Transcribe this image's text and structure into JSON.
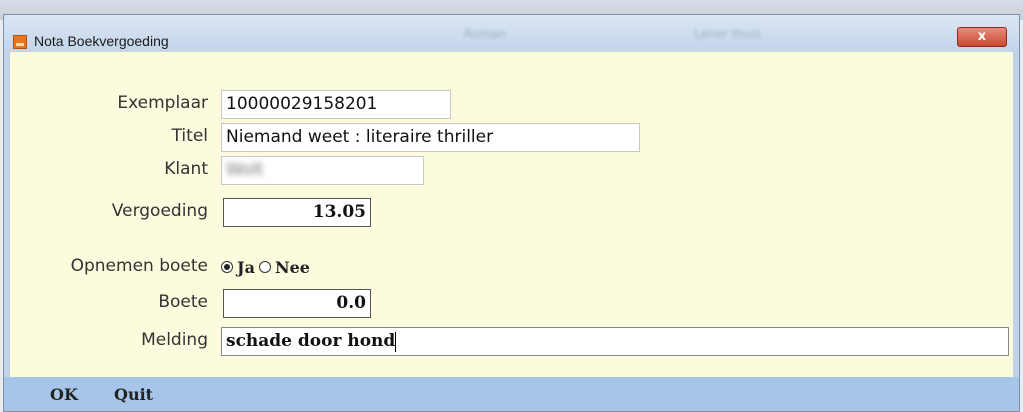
{
  "window": {
    "title": "Nota Boekvergoeding",
    "close_glyph": "x",
    "background_ghost_text": [
      "Roman",
      "Lener thuis"
    ]
  },
  "form": {
    "exemplaar": {
      "label": "Exemplaar",
      "value": "10000029158201"
    },
    "titel": {
      "label": "Titel",
      "value": "Niemand weet : literaire thriller"
    },
    "klant": {
      "label": "Klant",
      "value": "Wolt"
    },
    "vergoeding": {
      "label": "Vergoeding",
      "value": "13.05"
    },
    "opnemen_boete": {
      "label": "Opnemen boete",
      "options": [
        "Ja",
        "Nee"
      ],
      "selected": "Ja"
    },
    "boete": {
      "label": "Boete",
      "value": "0.0"
    },
    "melding": {
      "label": "Melding",
      "value": "schade door hond"
    }
  },
  "buttons": {
    "ok": "OK",
    "quit": "Quit"
  },
  "colors": {
    "form_background": "#fdfbde",
    "button_bar": "#a7c5e8",
    "title_bar": "#c4d5ea",
    "close_button": "#c94a35"
  }
}
